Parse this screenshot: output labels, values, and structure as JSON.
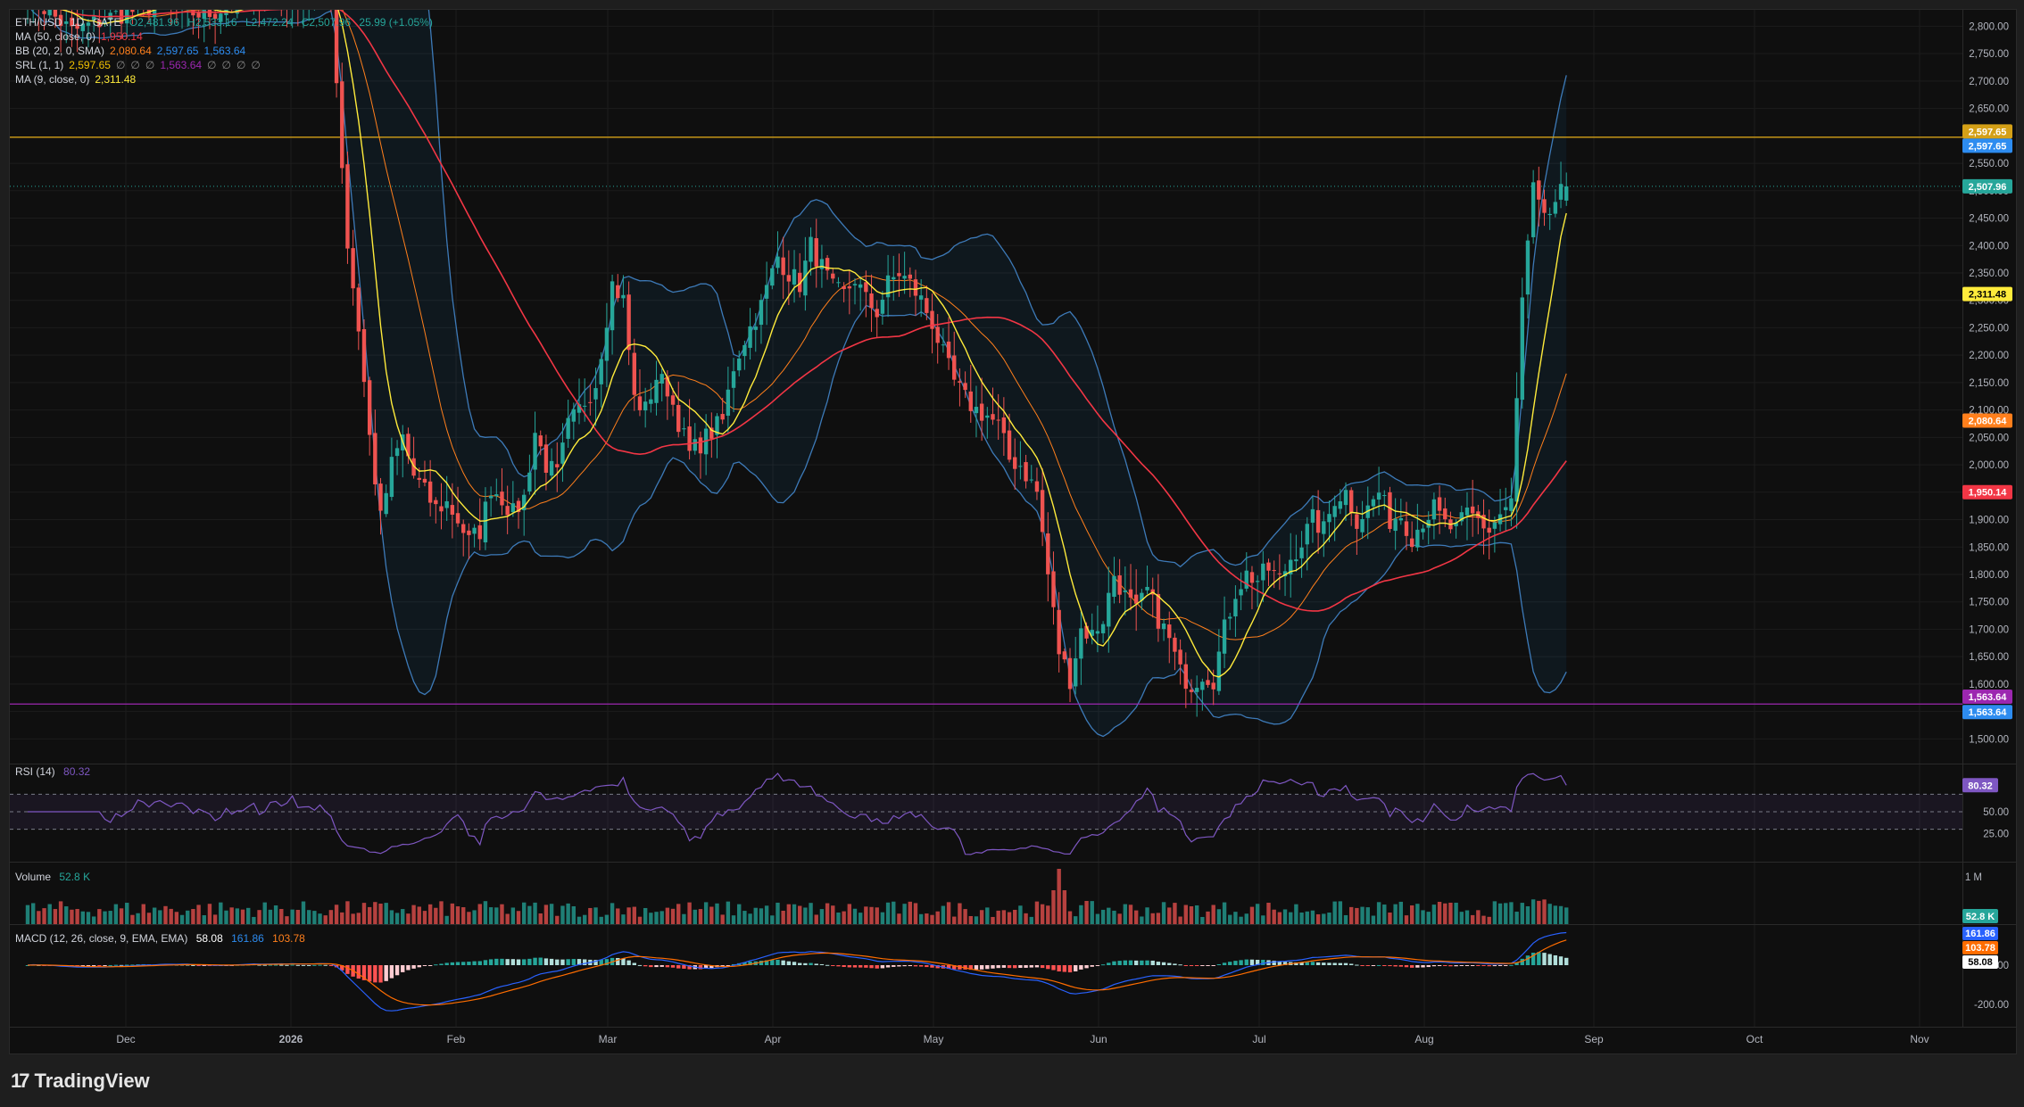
{
  "header": {
    "symbol": "ETH/USD",
    "interval": "1D",
    "exchange": "GATE",
    "ohlc": {
      "open": "O2,481.96",
      "high": "H2,533.16",
      "low": "L2,472.24",
      "close": "C2,507.96",
      "change": "25.99 (+1.05%)"
    }
  },
  "indicators": [
    {
      "label": "MA (50, close, 0)",
      "values": [
        "1,950.14"
      ],
      "colors": [
        "#f23645"
      ]
    },
    {
      "label": "BB (20, 2, 0, SMA)",
      "values": [
        "2,080.64",
        "2,597.65",
        "1,563.64"
      ],
      "colors": [
        "#ff7f1c",
        "#2d8cf0",
        "#2d8cf0"
      ]
    },
    {
      "label": "SRL (1, 1)",
      "values": [
        "2,597.65",
        "∅",
        "∅",
        "∅",
        "1,563.64",
        "∅",
        "∅",
        "∅",
        "∅"
      ],
      "colors": [
        "#f0c000",
        "#888",
        "#888",
        "#888",
        "#9c27b0",
        "#888",
        "#888",
        "#888",
        "#888"
      ]
    },
    {
      "label": "MA (9, close, 0)",
      "values": [
        "2,311.48"
      ],
      "colors": [
        "#ffeb3b"
      ]
    }
  ],
  "colors": {
    "up": "#26a69a",
    "down": "#ef5350",
    "bb": "#3d7ab8",
    "ma9": "#ffeb3b",
    "ma50": "#f23645",
    "basis": "#ff7f1c",
    "resistance": "#d4a017",
    "support": "#9c27b0",
    "rsi": "#7e57c2",
    "macd": "#2962ff",
    "signal": "#ff6d00",
    "bg": "#0f0f0f"
  },
  "price_axis": {
    "ticks": [
      "2,800.00",
      "2,750.00",
      "2,700.00",
      "2,650.00",
      "2,550.00",
      "2,500.00",
      "2,450.00",
      "2,400.00",
      "2,350.00",
      "2,300.00",
      "2,250.00",
      "2,200.00",
      "2,150.00",
      "2,100.00",
      "2,050.00",
      "2,000.00",
      "1,950.00",
      "1,900.00",
      "1,850.00",
      "1,800.00",
      "1,750.00",
      "1,700.00",
      "1,650.00",
      "1,600.00",
      "1,550.00",
      "1,500.00"
    ],
    "tags": [
      {
        "text": "2,597.65",
        "value": 2608,
        "color": "#d4a017"
      },
      {
        "text": "2,597.65",
        "value": 2582,
        "color": "#2d8cf0"
      },
      {
        "text": "2,507.96",
        "value": 2507.96,
        "color": "#26a69a"
      },
      {
        "text": "2,311.48",
        "value": 2311.48,
        "color": "#ffeb3b",
        "dark": true
      },
      {
        "text": "2,080.64",
        "value": 2080.64,
        "color": "#ff7f1c"
      },
      {
        "text": "1,950.14",
        "value": 1950.14,
        "color": "#f23645"
      },
      {
        "text": "1,563.64",
        "value": 1577,
        "color": "#9c27b0"
      },
      {
        "text": "1,563.64",
        "value": 1549,
        "color": "#2d8cf0"
      }
    ]
  },
  "time_axis": {
    "labels": [
      "Dec",
      "2026",
      "Feb",
      "Mar",
      "Apr",
      "May",
      "Jun",
      "Jul",
      "Aug",
      "Sep",
      "Oct",
      "Nov"
    ]
  },
  "rsi": {
    "label": "RSI (14)",
    "value": "80.32",
    "ticks": [
      "50.00",
      "25.00"
    ]
  },
  "volume": {
    "label": "Volume",
    "value": "52.8 K",
    "ticks": [
      "1 M"
    ]
  },
  "macd": {
    "label": "MACD (12, 26, close, 9, EMA, EMA)",
    "values": [
      "58.08",
      "161.86",
      "103.78"
    ],
    "tags": [
      "161.86",
      "103.78",
      "58.08"
    ],
    "ticks": [
      "0.00",
      "-200.00"
    ]
  },
  "brand": "TradingView",
  "chart_data": {
    "type": "candlestick",
    "title": "",
    "ylim": [
      1455,
      2830
    ],
    "levels": {
      "resistance": 2597.65,
      "support": 1563.64,
      "last": 2507.96
    },
    "x_labels": [
      "Dec",
      "2026",
      "Feb",
      "Mar",
      "Apr",
      "May",
      "Jun",
      "Jul",
      "Aug",
      "Sep",
      "Oct",
      "Nov"
    ],
    "close_anchors": [
      [
        0,
        2860
      ],
      [
        8,
        2790
      ],
      [
        16,
        2820
      ],
      [
        24,
        2840
      ],
      [
        32,
        2820
      ],
      [
        40,
        2850
      ],
      [
        48,
        2860
      ],
      [
        55,
        2860
      ],
      [
        56,
        2700
      ],
      [
        58,
        2400
      ],
      [
        60,
        2250
      ],
      [
        62,
        2050
      ],
      [
        64,
        1900
      ],
      [
        66,
        2000
      ],
      [
        68,
        2050
      ],
      [
        70,
        1980
      ],
      [
        72,
        1950
      ],
      [
        74,
        1920
      ],
      [
        76,
        1930
      ],
      [
        78,
        1900
      ],
      [
        80,
        1860
      ],
      [
        82,
        1880
      ],
      [
        84,
        1960
      ],
      [
        86,
        1940
      ],
      [
        88,
        1910
      ],
      [
        90,
        1940
      ],
      [
        92,
        2060
      ],
      [
        94,
        2000
      ],
      [
        96,
        1980
      ],
      [
        98,
        2070
      ],
      [
        100,
        2100
      ],
      [
        103,
        2150
      ],
      [
        106,
        2330
      ],
      [
        108,
        2300
      ],
      [
        110,
        2120
      ],
      [
        112,
        2100
      ],
      [
        114,
        2160
      ],
      [
        116,
        2140
      ],
      [
        118,
        2080
      ],
      [
        120,
        2020
      ],
      [
        122,
        2040
      ],
      [
        124,
        2060
      ],
      [
        126,
        2080
      ],
      [
        128,
        2180
      ],
      [
        130,
        2230
      ],
      [
        133,
        2290
      ],
      [
        136,
        2380
      ],
      [
        138,
        2350
      ],
      [
        140,
        2330
      ],
      [
        142,
        2400
      ],
      [
        144,
        2360
      ],
      [
        146,
        2320
      ],
      [
        148,
        2310
      ],
      [
        150,
        2340
      ],
      [
        152,
        2300
      ],
      [
        154,
        2280
      ],
      [
        156,
        2330
      ],
      [
        158,
        2350
      ],
      [
        160,
        2330
      ],
      [
        162,
        2300
      ],
      [
        164,
        2260
      ],
      [
        166,
        2200
      ],
      [
        168,
        2150
      ],
      [
        170,
        2120
      ],
      [
        172,
        2100
      ],
      [
        174,
        2090
      ],
      [
        176,
        2070
      ],
      [
        178,
        2010
      ],
      [
        180,
        2000
      ],
      [
        183,
        1950
      ],
      [
        185,
        1800
      ],
      [
        187,
        1660
      ],
      [
        189,
        1610
      ],
      [
        191,
        1700
      ],
      [
        193,
        1690
      ],
      [
        195,
        1720
      ],
      [
        197,
        1800
      ],
      [
        199,
        1760
      ],
      [
        201,
        1730
      ],
      [
        203,
        1770
      ],
      [
        205,
        1720
      ],
      [
        207,
        1680
      ],
      [
        209,
        1620
      ],
      [
        211,
        1600
      ],
      [
        213,
        1620
      ],
      [
        215,
        1610
      ],
      [
        217,
        1700
      ],
      [
        219,
        1770
      ],
      [
        221,
        1800
      ],
      [
        223,
        1790
      ],
      [
        225,
        1810
      ],
      [
        227,
        1790
      ],
      [
        229,
        1830
      ],
      [
        231,
        1860
      ],
      [
        233,
        1900
      ],
      [
        235,
        1880
      ],
      [
        237,
        1940
      ],
      [
        239,
        1950
      ],
      [
        241,
        1900
      ],
      [
        243,
        1920
      ],
      [
        245,
        1950
      ],
      [
        247,
        1900
      ],
      [
        249,
        1910
      ],
      [
        251,
        1870
      ],
      [
        253,
        1900
      ],
      [
        255,
        1920
      ],
      [
        257,
        1890
      ],
      [
        259,
        1880
      ],
      [
        261,
        1910
      ],
      [
        263,
        1900
      ],
      [
        265,
        1880
      ],
      [
        267,
        1910
      ],
      [
        269,
        1930
      ],
      [
        271,
        2300
      ],
      [
        273,
        2500
      ],
      [
        275,
        2440
      ],
      [
        277,
        2480
      ],
      [
        279,
        2508
      ]
    ],
    "rsi_last": 80.32,
    "volume_last": "52.8 K",
    "macd_last": {
      "macd": 161.86,
      "signal": 103.78,
      "hist": 58.08
    }
  }
}
